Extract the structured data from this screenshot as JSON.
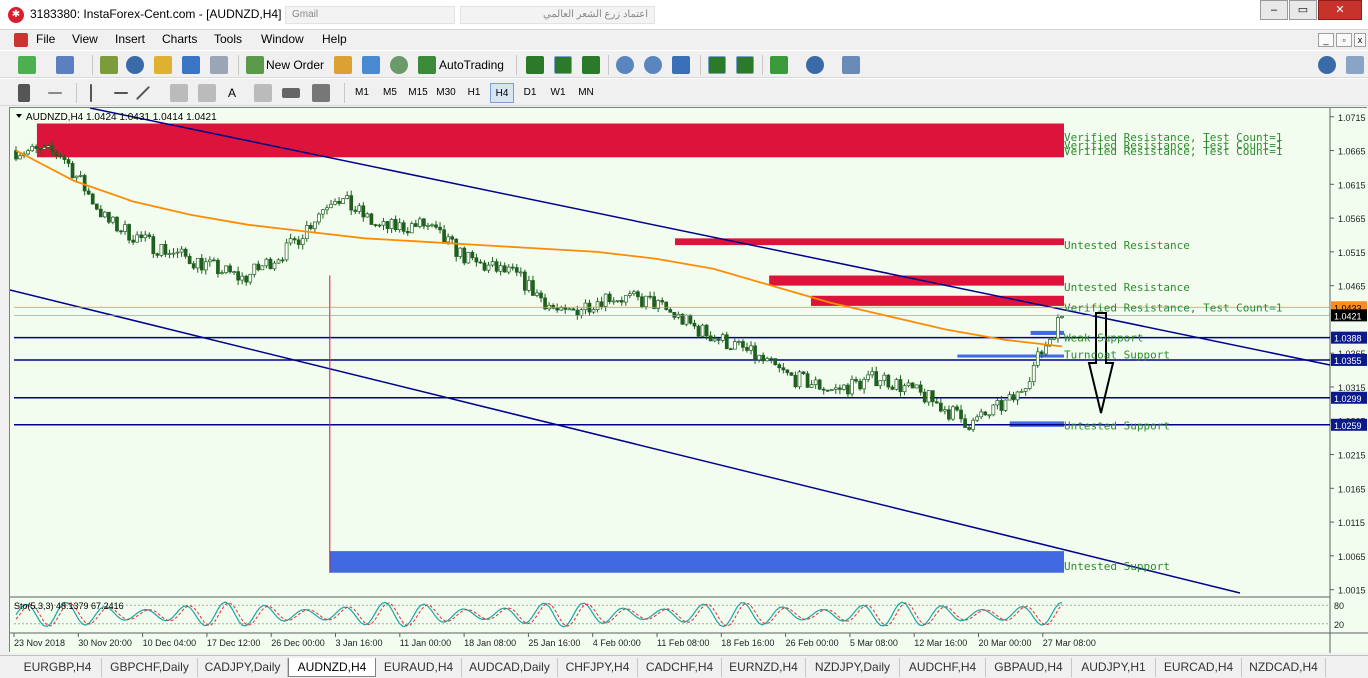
{
  "window": {
    "title": "3183380: InstaForex-Cent.com - [AUDNZD,H4]",
    "ghost_tabs": [
      "Gmail",
      "اعتماد زرع الشعر العالمي",
      ""
    ],
    "buttons": [
      "‒",
      "▭",
      "✕"
    ]
  },
  "menu": [
    "File",
    "View",
    "Insert",
    "Charts",
    "Tools",
    "Window",
    "Help"
  ],
  "toolbar1": {
    "new_order": "New Order",
    "auto_trading": "AutoTrading"
  },
  "timeframes": [
    "M1",
    "M5",
    "M15",
    "M30",
    "H1",
    "H4",
    "D1",
    "W1",
    "MN"
  ],
  "active_timeframe": "H4",
  "chart_header": "AUDNZD,H4  1.0424 1.0431 1.0414 1.0421",
  "price_axis": [
    "1.0715",
    "1.0665",
    "1.0615",
    "1.0565",
    "1.0515",
    "1.0465",
    "1.0365",
    "1.0315",
    "1.0265",
    "1.0215",
    "1.0165",
    "1.0115",
    "1.0065",
    "1.0015"
  ],
  "price_tags": [
    {
      "label": "1.0433",
      "color": "#ff8c1a",
      "text_color": "#000000"
    },
    {
      "label": "1.0421",
      "color": "#000000",
      "text_color": "#ffffff"
    },
    {
      "label": "1.0388",
      "color": "#0a1a8c",
      "text_color": "#ffffff"
    },
    {
      "label": "1.0355",
      "color": "#0a1a8c",
      "text_color": "#ffffff"
    },
    {
      "label": "1.0299",
      "color": "#0a1a8c",
      "text_color": "#ffffff"
    },
    {
      "label": "1.0259",
      "color": "#0a1a8c",
      "text_color": "#ffffff"
    }
  ],
  "zone_labels": [
    "Verified Resistance, Test Count=1",
    "Verified Resistance, Test Count=1",
    "Verified Resistance, Test Count=1",
    "Untested Resistance",
    "Untested Resistance",
    "Verified Resistance, Test Count=1",
    "Weak Support",
    "Turncoat Support",
    "Untested Support",
    "Untested Support"
  ],
  "oscillator": {
    "label": "Sto(5,3,3) 48.1379 67.2416",
    "levels": [
      "80",
      "20"
    ]
  },
  "time_axis": [
    "23 Nov 2018",
    "30 Nov 20:00",
    "10 Dec 04:00",
    "17 Dec 12:00",
    "26 Dec 00:00",
    "3 Jan 16:00",
    "11 Jan 00:00",
    "18 Jan 08:00",
    "25 Jan 16:00",
    "4 Feb 00:00",
    "11 Feb 08:00",
    "18 Feb 16:00",
    "26 Feb 00:00",
    "5 Mar 08:00",
    "12 Mar 16:00",
    "20 Mar 00:00",
    "27 Mar 08:00"
  ],
  "symbol_tabs": [
    "EURGBP,H4",
    "GBPCHF,Daily",
    "CADJPY,Daily",
    "AUDNZD,H4",
    "EURAUD,H4",
    "AUDCAD,Daily",
    "CHFJPY,H4",
    "CADCHF,H4",
    "EURNZD,H4",
    "NZDJPY,Daily",
    "AUDCHF,H4",
    "GBPAUD,H4",
    "AUDJPY,H1",
    "EURCAD,H4",
    "NZDCAD,H4"
  ],
  "active_symbol_tab": "AUDNZD,H4",
  "colors": {
    "zone_resistance": "#dc143c",
    "zone_support": "#4169e1",
    "trend_line": "#00008b",
    "moving_average": "#ff8c00",
    "chart_bg": "#f2fdf0",
    "zone_text": "#2e8b2e"
  },
  "chart_data": {
    "type": "candlestick",
    "symbol": "AUDNZD",
    "timeframe": "H4",
    "ohlc_last": {
      "open": 1.0424,
      "high": 1.0431,
      "low": 1.0414,
      "close": 1.0421
    },
    "ylim": [
      1.001,
      1.0725
    ],
    "x_categories": [
      "23 Nov 2018",
      "30 Nov 20:00",
      "10 Dec 04:00",
      "17 Dec 12:00",
      "26 Dec 00:00",
      "3 Jan 16:00",
      "11 Jan 00:00",
      "18 Jan 08:00",
      "25 Jan 16:00",
      "4 Feb 00:00",
      "11 Feb 08:00",
      "18 Feb 16:00",
      "26 Feb 00:00",
      "5 Mar 08:00",
      "12 Mar 16:00",
      "20 Mar 00:00",
      "27 Mar 08:00"
    ],
    "approx_closes": [
      1.0665,
      1.066,
      1.056,
      1.0525,
      1.05,
      1.0475,
      1.052,
      1.06,
      1.055,
      1.0555,
      1.05,
      1.048,
      1.042,
      1.045,
      1.044,
      1.04,
      1.037,
      1.033,
      1.031,
      1.033,
      1.03,
      1.026,
      1.03,
      1.0421
    ],
    "moving_average": [
      1.0665,
      1.062,
      1.059,
      1.057,
      1.0555,
      1.0545,
      1.0535,
      1.053,
      1.0525,
      1.052,
      1.0515,
      1.0505,
      1.049,
      1.0465,
      1.044,
      1.042,
      1.04,
      1.0385,
      1.0375
    ],
    "horizontal_lines": [
      1.0388,
      1.0355,
      1.0299,
      1.0259
    ],
    "zones": [
      {
        "type": "resistance",
        "low": 1.0655,
        "high": 1.0705,
        "label": "Verified Resistance, Test Count=1"
      },
      {
        "type": "resistance",
        "low": 1.0525,
        "high": 1.0535,
        "label": "Untested Resistance"
      },
      {
        "type": "resistance",
        "low": 1.0465,
        "high": 1.048,
        "label": "Untested Resistance"
      },
      {
        "type": "resistance",
        "low": 1.0435,
        "high": 1.045,
        "label": "Verified Resistance, Test Count=1"
      },
      {
        "type": "support",
        "low": 1.0392,
        "high": 1.0398,
        "label": "Weak Support"
      },
      {
        "type": "support",
        "low": 1.036,
        "high": 1.0363,
        "label": "Turncoat Support"
      },
      {
        "type": "support",
        "low": 1.0256,
        "high": 1.0264,
        "label": "Untested Support"
      },
      {
        "type": "support",
        "low": 1.004,
        "high": 1.0072,
        "label": "Untested Support"
      }
    ]
  }
}
